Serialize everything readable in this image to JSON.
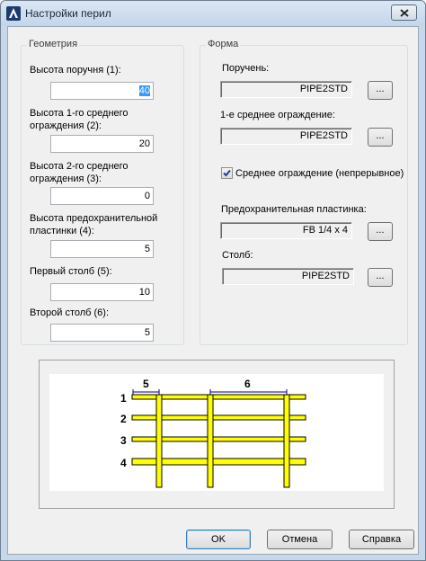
{
  "window": {
    "title": "Настройки перил"
  },
  "geometry": {
    "title": "Геометрия",
    "fields": [
      {
        "label": "Высота поручня (1):",
        "value": "40"
      },
      {
        "label": "Высота 1-го среднего ограждения (2):",
        "value": "20"
      },
      {
        "label": "Высота 2-го среднего ограждения (3):",
        "value": "0"
      },
      {
        "label": "Высота предохранительной пластинки (4):",
        "value": "5"
      },
      {
        "label": "Первый столб (5):",
        "value": "10"
      },
      {
        "label": "Второй столб (6):",
        "value": "5"
      }
    ]
  },
  "shape": {
    "title": "Форма",
    "handrail": {
      "label": "Поручень:",
      "value": "PIPE2STD"
    },
    "midrail1": {
      "label": "1-е среднее ограждение:",
      "value": "PIPE2STD"
    },
    "continuous": {
      "label": "Среднее ограждение (непрерывное)",
      "checked": true
    },
    "toeplate": {
      "label": "Предохранительная пластинка:",
      "value": "FB 1/4 x 4"
    },
    "post": {
      "label": "Столб:",
      "value": "PIPE2STD"
    },
    "browse_label": "..."
  },
  "preview": {
    "row_labels": [
      "1",
      "2",
      "3",
      "4"
    ],
    "dim_labels": [
      "5",
      "6"
    ],
    "rail_color": "#ffff00"
  },
  "buttons": {
    "ok": "OK",
    "cancel": "Отмена",
    "help": "Справка"
  }
}
